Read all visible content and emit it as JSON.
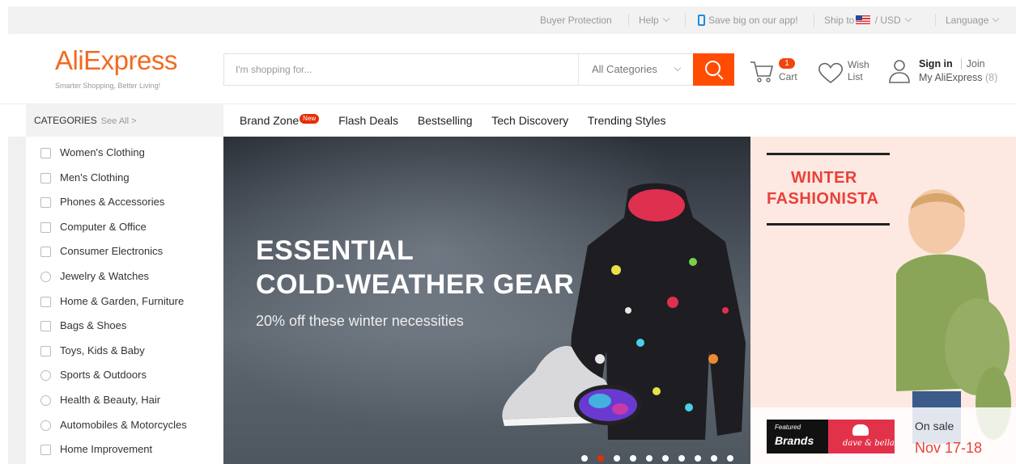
{
  "topbar": {
    "buyer_protection": "Buyer Protection",
    "help": "Help",
    "app": "Save big on our app!",
    "ship_to": "Ship to",
    "currency": "/ USD",
    "language": "Language"
  },
  "header": {
    "logo": "AliExpress",
    "tagline": "Smarter Shopping, Better Living!",
    "search_placeholder": "I'm shopping for...",
    "category_select": "All Categories",
    "cart_count": "1",
    "cart_label": "Cart",
    "wish_line1": "Wish",
    "wish_line2": "List",
    "sign_in": "Sign in",
    "join": "Join",
    "my_aliexpress": "My AliExpress",
    "my_count": "(8)"
  },
  "nav": {
    "categories": "CATEGORIES",
    "see_all": "See All >",
    "links": [
      "Brand Zone",
      "Flash Deals",
      "Bestselling",
      "Tech Discovery",
      "Trending Styles"
    ],
    "new_badge": "New"
  },
  "categories": [
    "Women's Clothing",
    "Men's Clothing",
    "Phones & Accessories",
    "Computer & Office",
    "Consumer Electronics",
    "Jewelry & Watches",
    "Home & Garden, Furniture",
    "Bags & Shoes",
    "Toys, Kids & Baby",
    "Sports & Outdoors",
    "Health & Beauty, Hair",
    "Automobiles & Motorcycles",
    "Home Improvement"
  ],
  "banner": {
    "title_line1": "ESSENTIAL",
    "title_line2": "COLD-WEATHER GEAR",
    "subtitle": "20% off these winter necessities",
    "slide_count": 10,
    "active_slide": 2
  },
  "promo": {
    "title_line1": "WINTER",
    "title_line2": "FASHIONISTA",
    "featured_line1": "Featured",
    "featured_line2": "Brands",
    "brand": "dave & bella",
    "on_sale": "On sale",
    "date": "Nov 17-18"
  },
  "colors": {
    "brand_orange": "#f26a21",
    "search_button": "#ff4c00",
    "badge_red": "#e62e04",
    "promo_red": "#e8413a"
  }
}
